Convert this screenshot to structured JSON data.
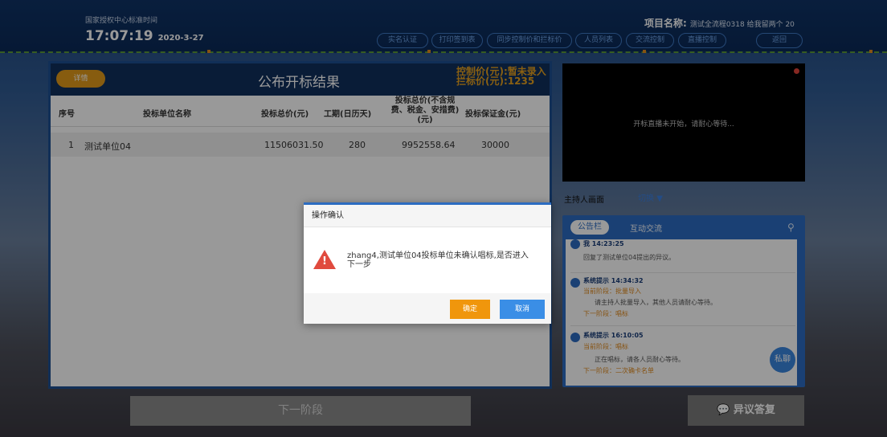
{
  "header": {
    "org_label": "国家授权中心标准时间",
    "time": "17:07:19",
    "date": "2020-3-27",
    "project_label": "项目名称:",
    "project_value": "测试全流程0318 给我留两个 20",
    "nav": [
      "实名认证",
      "打印签到表",
      "同步控制价和拦标价",
      "人员列表",
      "交流控制",
      "直播控制",
      "返回"
    ]
  },
  "left": {
    "detail_button": "详情",
    "title": "公布开标结果",
    "control_price": "控制价(元):暂未录入",
    "intercept_price": "拦标价(元):1235",
    "columns": [
      "序号",
      "投标单位名称",
      "投标总价(元)",
      "工期(日历天)",
      "投标总价(不含规费、税金、安措费)(元)",
      "投标保证金(元)"
    ],
    "rows": [
      {
        "no": "1",
        "name": "测试单位04",
        "total": "11506031.50",
        "days": "280",
        "net": "9952558.64",
        "deposit": "30000"
      }
    ]
  },
  "bottom": {
    "next_stage": "下一阶段",
    "objection_reply": "异议答复"
  },
  "video": {
    "placeholder": "开标直播未开始，请耐心等待...",
    "host_label": "主持人画面",
    "switch_label": "切换"
  },
  "notice": {
    "tab_board": "公告栏",
    "tab_chat": "互动交流",
    "private_chat": "私聊",
    "messages": [
      {
        "head": "我 14:23:25",
        "lines": [
          "回复了测试单位04提出的异议。"
        ]
      },
      {
        "head": "系统提示 14:34:32",
        "lines": [
          "当前阶段：批量导入",
          "请主持人批量导入，其他人员请耐心等待。",
          "下一阶段：唱标"
        ]
      },
      {
        "head": "系统提示 16:10:05",
        "lines": [
          "当前阶段：唱标",
          "正在唱标，请各人员耐心等待。",
          "下一阶段：二次确卡名单"
        ]
      }
    ]
  },
  "dialog": {
    "title": "操作确认",
    "message": "zhang4,测试单位04投标单位未确认唱标,是否进入下一步",
    "confirm": "确定",
    "cancel": "取消"
  },
  "colors": {
    "accent_blue": "#2c6cc1",
    "warning_orange": "#f0960c",
    "danger_red": "#e04a3e"
  }
}
